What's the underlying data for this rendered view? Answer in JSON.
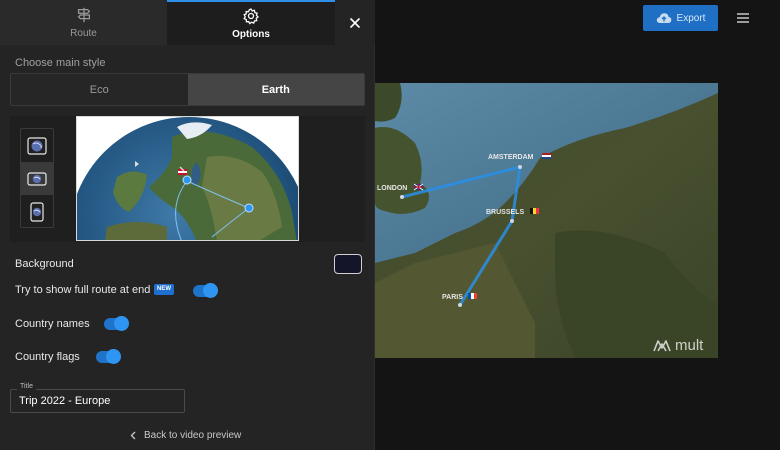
{
  "tabs": [
    {
      "label": "Route",
      "icon": "signpost-icon"
    },
    {
      "label": "Options",
      "icon": "gear-icon"
    }
  ],
  "style": {
    "section_label": "Choose main style",
    "options": [
      "Eco",
      "Earth"
    ],
    "selected": "Earth"
  },
  "views": [
    "globe-landscape-icon",
    "globe-widescreen-icon",
    "globe-portrait-icon"
  ],
  "settings": {
    "background_label": "Background",
    "background_color": "#15152a",
    "full_route_label": "Try to show full route at end",
    "new_badge": "NEW",
    "country_names_label": "Country names",
    "country_flags_label": "Country flags",
    "full_route_on": true,
    "country_names_on": true,
    "country_flags_on": true
  },
  "title_field": {
    "legend": "Title",
    "value": "Trip 2022 - Europe"
  },
  "back_label": "Back to video preview",
  "export_label": "Export",
  "map": {
    "cities": [
      {
        "name": "AMSTERDAM",
        "flag": "nl"
      },
      {
        "name": "LONDON",
        "flag": "gb"
      },
      {
        "name": "BRUSSELS",
        "flag": "be"
      },
      {
        "name": "PARIS",
        "flag": "fr"
      }
    ],
    "brand": "mult"
  },
  "colors": {
    "accent": "#1f6fc4",
    "route_line": "#2a8fe6",
    "toggle_on": "#2f95f2"
  }
}
